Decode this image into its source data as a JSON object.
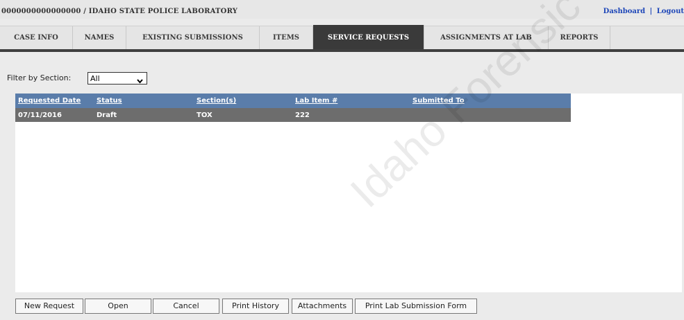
{
  "header": {
    "case_title": "0000000000000000 / IDAHO STATE POLICE LABORATORY",
    "links": {
      "dashboard": "Dashboard",
      "separator": "|",
      "logout": "Logout"
    }
  },
  "tabs": [
    {
      "label": "CASE INFO"
    },
    {
      "label": "NAMES"
    },
    {
      "label": "EXISTING SUBMISSIONS"
    },
    {
      "label": "ITEMS"
    },
    {
      "label": "SERVICE REQUESTS"
    },
    {
      "label": "ASSIGNMENTS AT LAB"
    },
    {
      "label": "REPORTS"
    }
  ],
  "filter": {
    "label": "Filter by Section:",
    "selected": "All"
  },
  "grid": {
    "columns": [
      "Requested Date",
      "Status",
      "Section(s)",
      "Lab Item #",
      "Submitted To"
    ],
    "rows": [
      {
        "requested_date": "07/11/2016",
        "status": "Draft",
        "sections": "TOX",
        "lab_item": "222",
        "submitted_to": ""
      }
    ]
  },
  "buttons": {
    "new_request": "New Request",
    "open": "Open",
    "cancel": "Cancel",
    "print_history": "Print History",
    "attachments": "Attachments",
    "print_form": "Print Lab Submission Form"
  },
  "watermark": "Idaho Forensic Services"
}
